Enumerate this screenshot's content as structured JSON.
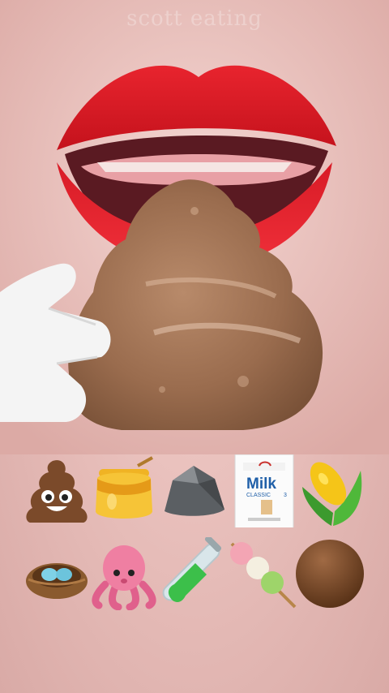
{
  "watermark": "scott eating",
  "carton": {
    "brand": "Milk",
    "line": "CLASSIC",
    "number": "3"
  },
  "emojis": {
    "row1": [
      "poop-emoji",
      "honey-pot-emoji",
      "rock-emoji",
      "milk-carton-emoji",
      "corn-emoji"
    ],
    "row2": [
      "nest-with-eggs-emoji",
      "octopus-emoji",
      "test-tube-emoji",
      "dango-emoji",
      "brown-circle-emoji"
    ]
  }
}
